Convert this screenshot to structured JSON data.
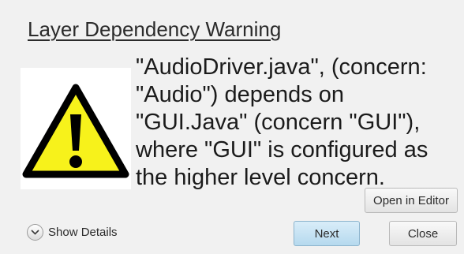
{
  "dialog": {
    "title": "Layer Dependency Warning",
    "icon": "warning-triangle-icon",
    "message": "\"AudioDriver.java\", (concern: \"Audio\") depends on \"GUI.Java\" (concern \"GUI\"), where \"GUI\" is configured as the higher level concern.",
    "colors": {
      "warning_fill": "#f7f21b",
      "warning_stroke": "#000000",
      "next_button": "#c4e2f3"
    }
  },
  "buttons": {
    "open_editor": "Open in Editor",
    "next": "Next",
    "close": "Close"
  },
  "details": {
    "label": "Show Details",
    "icon": "chevron-down-icon"
  }
}
